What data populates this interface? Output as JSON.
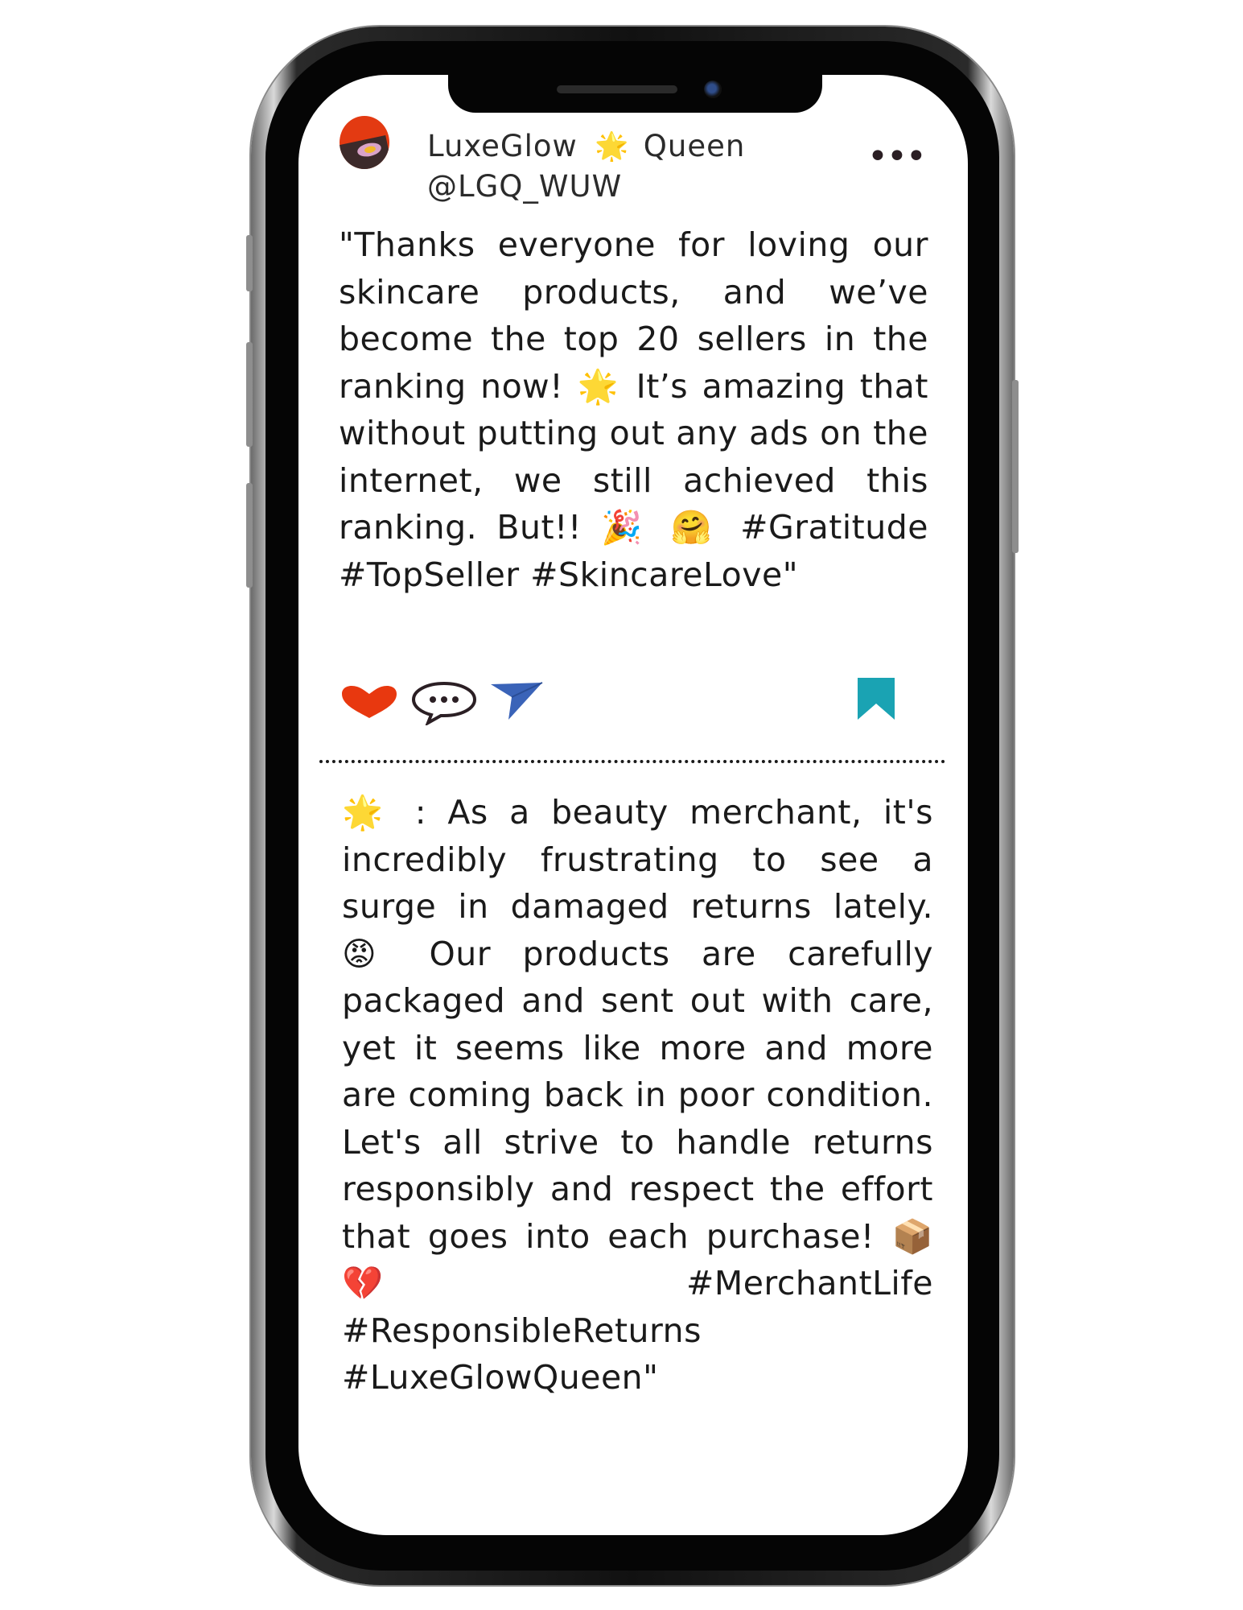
{
  "profile": {
    "name_part1": "LuxeGlow",
    "name_emoji": "🌟",
    "name_part2": "Queen",
    "handle": "@LGQ_WUW",
    "more_label": "•••"
  },
  "post1": {
    "text": "\"Thanks everyone for loving our skincare products, and we’ve become the top 20 sellers in the ranking now! 🌟 It’s amazing that without putting out any ads on the internet, we still achieved this ranking. But!! 🎉 🤗 #Gratitude #TopSeller #SkincareLove\""
  },
  "actions": {
    "like_icon": "heart-icon",
    "comment_icon": "comment-bubble-icon",
    "share_icon": "send-icon",
    "save_icon": "bookmark-icon",
    "colors": {
      "heart": "#e8380f",
      "send": "#3a63b8",
      "bookmark": "#1aa3b3",
      "comment": "#2b1f24"
    }
  },
  "comment": {
    "text": "🌟 : As a beauty merchant, it's incredibly frustrating to see a surge in damaged returns lately. 😡 Our products are carefully packaged and sent out with care, yet it seems like more and more are coming back in poor condition. Let's all strive to handle returns responsibly and respect the effort that goes into each purchase! 📦 💔 #MerchantLife #ResponsibleReturns #LuxeGlowQueen\""
  }
}
